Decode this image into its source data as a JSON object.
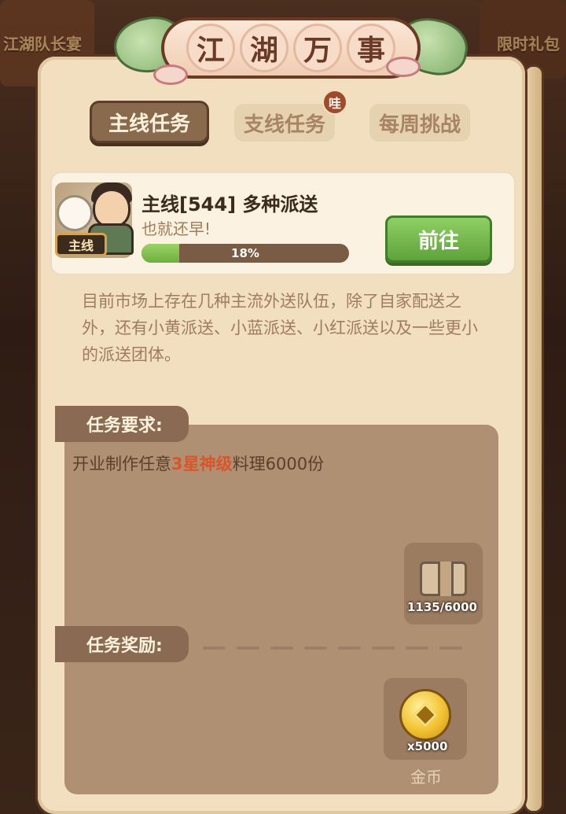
{
  "background": {
    "left_label": "江湖队长宴",
    "right_label": "限时礼包"
  },
  "title": {
    "chars": [
      "江",
      "湖",
      "万",
      "事"
    ]
  },
  "tabs": [
    {
      "label": "主线任务",
      "active": true
    },
    {
      "label": "支线任务",
      "active": false,
      "badge": "哇"
    },
    {
      "label": "每周挑战",
      "active": false
    }
  ],
  "quest": {
    "tag": "主线",
    "title": "主线[544] 多种派送",
    "subtitle": "也就还早!",
    "progress_percent": 18,
    "progress_label": "18%",
    "go_button": "前往"
  },
  "description": "目前市场上存在几种主流外送队伍，除了自家配送之外，还有小黄派送、小蓝派送、小红派送以及一些更小的派送团体。",
  "requirement": {
    "label": "任务要求:",
    "text_before": "开业制作任意",
    "highlight": "3星神级",
    "text_after": "料理6000份",
    "item_count": "1135/6000"
  },
  "reward": {
    "label": "任务奖励:",
    "item_count": "x5000",
    "item_name": "金币"
  },
  "colors": {
    "panel": "#f1dfc0",
    "accent_green": "#6fae3c",
    "highlight_red": "#d9552b"
  }
}
